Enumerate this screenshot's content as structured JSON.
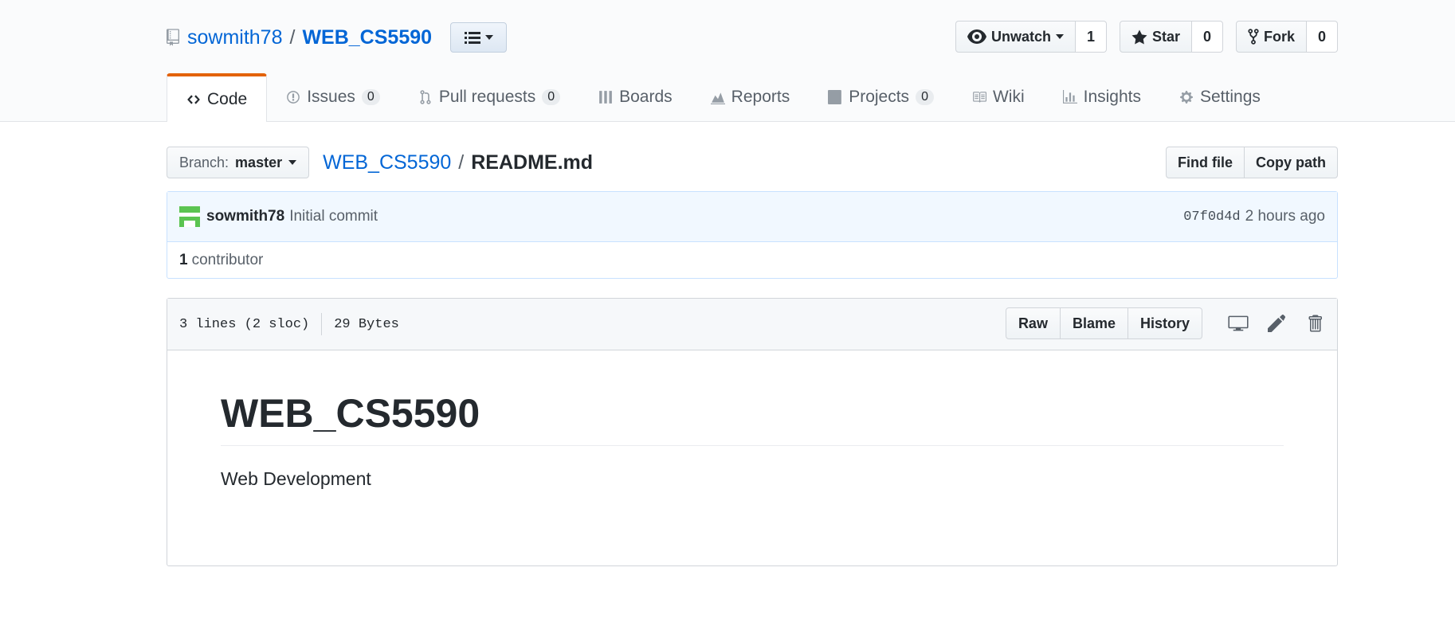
{
  "repo": {
    "owner": "sowmith78",
    "separator": "/",
    "name": "WEB_CS5590"
  },
  "actions": {
    "watch": {
      "label": "Unwatch",
      "count": "1"
    },
    "star": {
      "label": "Star",
      "count": "0"
    },
    "fork": {
      "label": "Fork",
      "count": "0"
    }
  },
  "tabs": [
    {
      "label": "Code",
      "icon": "code-icon"
    },
    {
      "label": "Issues",
      "icon": "issue-icon",
      "count": "0"
    },
    {
      "label": "Pull requests",
      "icon": "pull-request-icon",
      "count": "0"
    },
    {
      "label": "Boards",
      "icon": "boards-icon"
    },
    {
      "label": "Reports",
      "icon": "graph-icon"
    },
    {
      "label": "Projects",
      "icon": "project-icon",
      "count": "0"
    },
    {
      "label": "Wiki",
      "icon": "book-icon"
    },
    {
      "label": "Insights",
      "icon": "insights-icon"
    },
    {
      "label": "Settings",
      "icon": "gear-icon"
    }
  ],
  "file_nav": {
    "branch_label": "Branch:",
    "branch_value": "master",
    "breadcrumb_repo": "WEB_CS5590",
    "breadcrumb_sep": "/",
    "breadcrumb_file": "README.md",
    "find_file": "Find file",
    "copy_path": "Copy path"
  },
  "commit": {
    "author": "sowmith78",
    "message": "Initial commit",
    "sha": "07f0d4d",
    "time": "2 hours ago",
    "contributors_count": "1",
    "contributors_label": "contributor"
  },
  "file": {
    "lines": "3 lines (2 sloc)",
    "size": "29 Bytes",
    "raw": "Raw",
    "blame": "Blame",
    "history": "History",
    "icons": [
      "desktop-icon",
      "pencil-icon",
      "trash-icon"
    ]
  },
  "readme": {
    "heading": "WEB_CS5590",
    "body": "Web Development"
  },
  "colors": {
    "link": "#0366d6",
    "selected_tab_accent": "#e36209",
    "commit_bg": "#f1f8ff",
    "avatar": "#5bc451"
  }
}
